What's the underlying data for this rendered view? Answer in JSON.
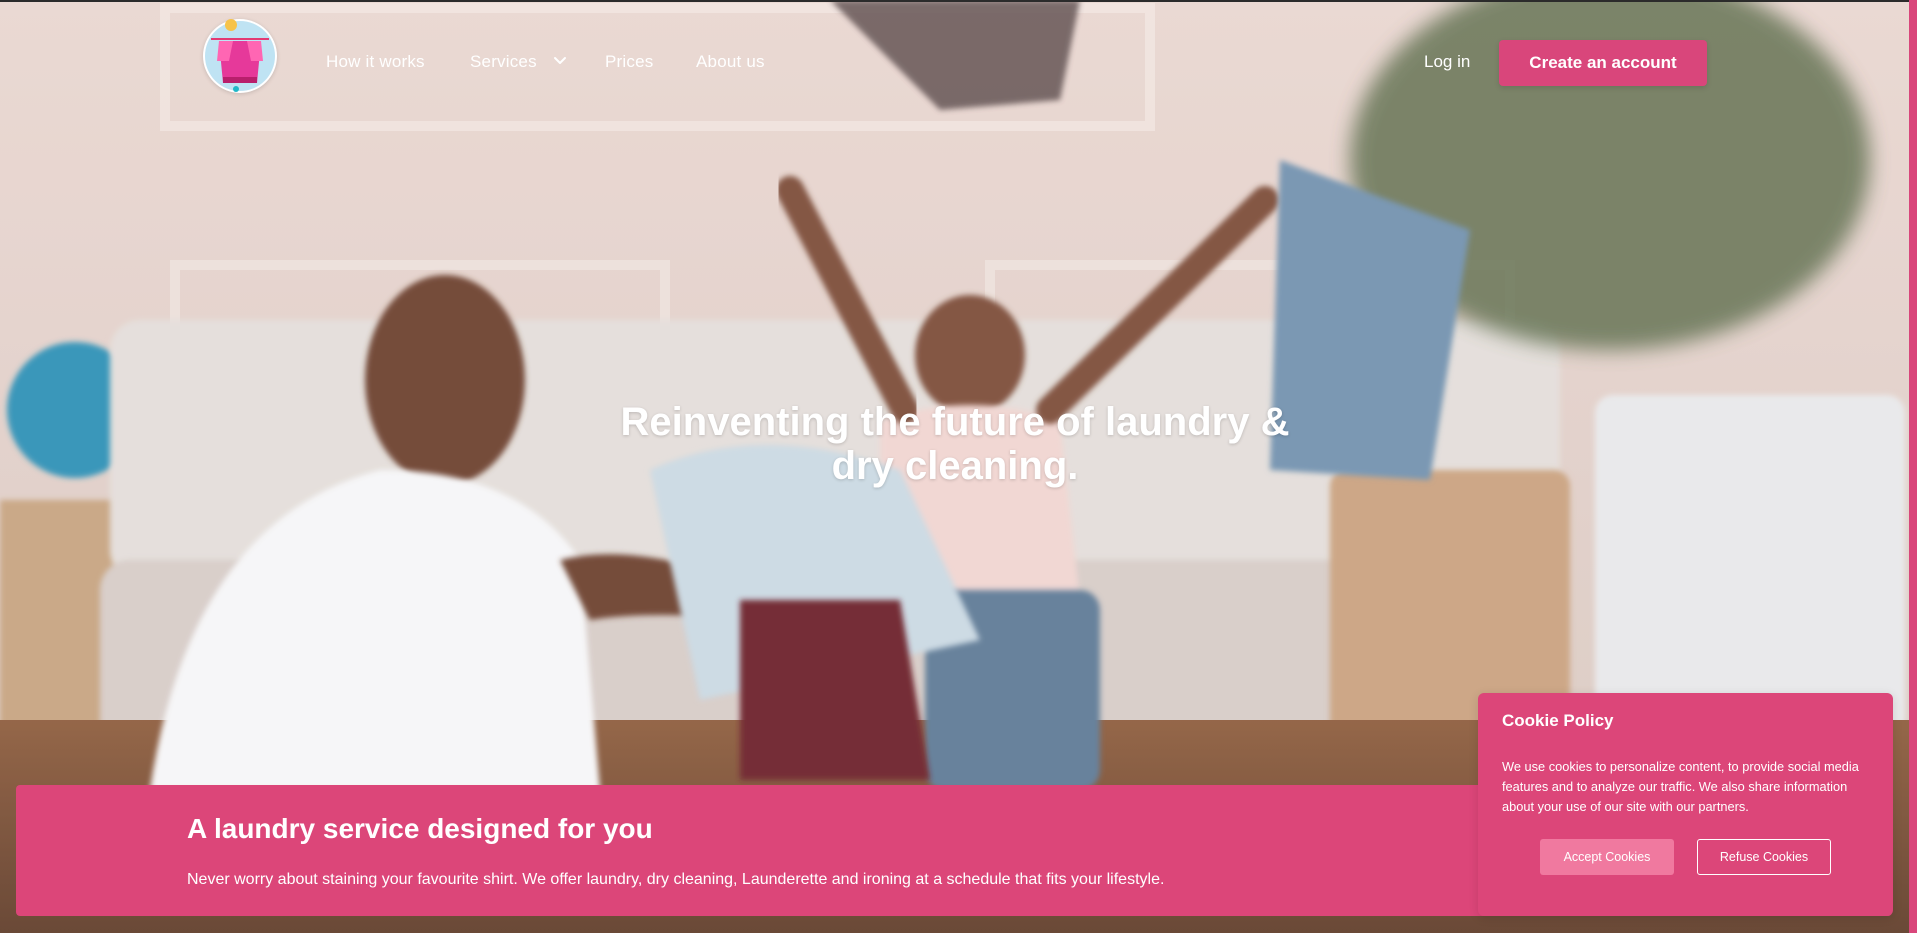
{
  "header": {
    "nav": [
      "How it works",
      "Services",
      "Prices",
      "About us"
    ],
    "login": "Log in",
    "create_account": "Create an account",
    "services_icon": "chevron-down-icon"
  },
  "hero": {
    "line1": "Reinventing the future of laundry &",
    "line2": "dry cleaning."
  },
  "band": {
    "title": "A laundry service designed for you",
    "desc": "Never worry about staining your favourite shirt. We offer laundry, dry cleaning, Launderette and ironing at a schedule that fits your lifestyle."
  },
  "cookie": {
    "title": "Cookie Policy",
    "text": "We use cookies to personalize content, to provide social media features and to analyze our traffic. We also share information about your use of our site with our partners.",
    "accept": "Accept Cookies",
    "refuse": "Refuse Cookies"
  },
  "colors": {
    "accent": "#dc4679",
    "accept_button": "#f0799f"
  }
}
